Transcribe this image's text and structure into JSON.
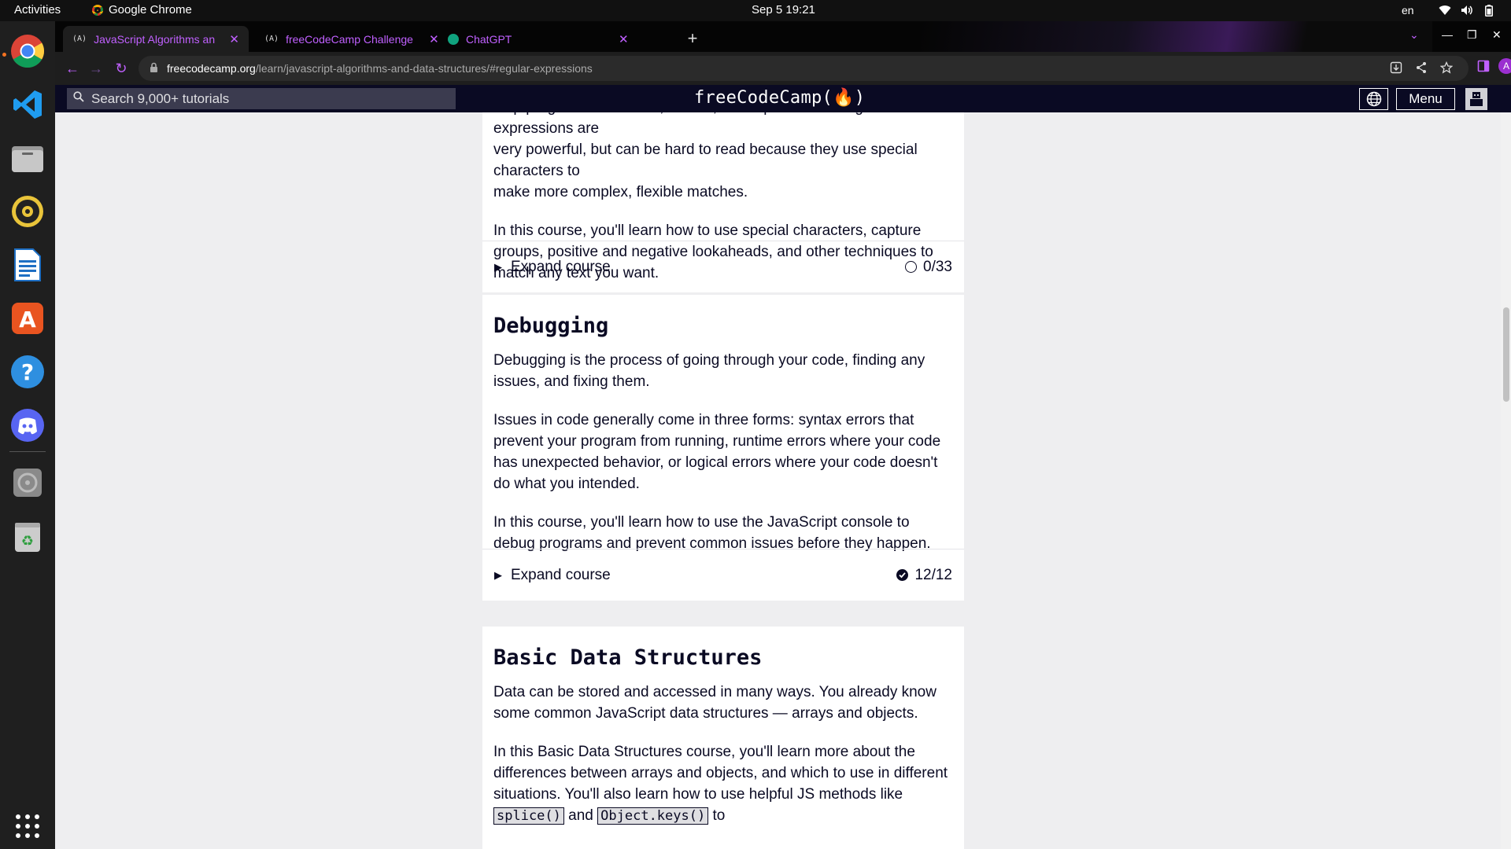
{
  "system": {
    "activities": "Activities",
    "app_name": "Google Chrome",
    "clock": "Sep 5  19:21",
    "language": "en"
  },
  "dock": {
    "apps": [
      "chrome-icon",
      "vscode-icon",
      "files-icon",
      "rhythmbox-icon",
      "writer-icon",
      "software-icon",
      "help-icon",
      "discord-icon",
      "disk-icon",
      "trash-icon",
      "app-grid-icon"
    ]
  },
  "browser": {
    "tabs": [
      {
        "favicon": "(A)",
        "title": "JavaScript Algorithms an"
      },
      {
        "favicon": "(A)",
        "title": "freeCodeCamp Challenge"
      },
      {
        "favicon": "gpt",
        "title": "ChatGPT"
      }
    ],
    "url_host": "freecodecamp.org",
    "url_path": "/learn/javascript-algorithms-and-data-structures/#regular-expressions",
    "profile_initial": "A"
  },
  "fcc": {
    "search_placeholder": "Search 9,000+ tutorials",
    "logo": "freeCodeCamp(🔥)",
    "menu_label": "Menu"
  },
  "sections": {
    "regex": {
      "p1_partial_top": "help programmers match, search, and replace text. Regular expressions are",
      "p1_line2": "very powerful, but can be hard to read because they use special characters to",
      "p1_line3": "make more complex, flexible matches.",
      "p2": "In this course, you'll learn how to use special characters, capture groups, positive and negative lookaheads, and other techniques to match any text you want.",
      "expand_label": "Expand course",
      "progress": "0/33"
    },
    "debugging": {
      "title": "Debugging",
      "p1": "Debugging is the process of going through your code, finding any issues, and fixing them.",
      "p2": "Issues in code generally come in three forms: syntax errors that prevent your program from running, runtime errors where your code has unexpected behavior, or logical errors where your code doesn't do what you intended.",
      "p3": "In this course, you'll learn how to use the JavaScript console to debug programs and prevent common issues before they happen.",
      "expand_label": "Expand course",
      "progress": "12/12"
    },
    "data_structures": {
      "title": "Basic Data Structures",
      "p1": "Data can be stored and accessed in many ways. You already know some common JavaScript data structures — arrays and objects.",
      "p2_a": "In this Basic Data Structures course, you'll learn more about the differences between arrays and objects, and which to use in different situations. You'll also learn how to use helpful JS methods like",
      "code1": "splice()",
      "p2_and": "and",
      "code2": "Object.keys()",
      "p2_to": "to"
    }
  }
}
